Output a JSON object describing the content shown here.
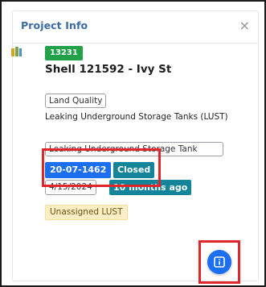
{
  "panel": {
    "title": "Project Info",
    "close_glyph": "×"
  },
  "project": {
    "id": "13231",
    "name": "Shell 121592 - Ivy St",
    "category": "Land Quality",
    "program": "Leaking Underground Storage Tanks (LUST)",
    "program_tag": "Leaking Underground Storage Tank",
    "permit_number": "20-07-1462",
    "status": "Closed",
    "date": "4/15/2024",
    "age": "10 months ago",
    "assignment": "Unassigned LUST"
  },
  "icons": {
    "layer": "layer-icon",
    "info": "info-icon"
  },
  "colors": {
    "title": "#3b6aa8",
    "id_badge": "#21a24a",
    "blue_badge": "#1d6ff2",
    "teal_badge": "#13849a",
    "highlight": "#e0252b",
    "unassigned_bg": "#fdeec5"
  }
}
